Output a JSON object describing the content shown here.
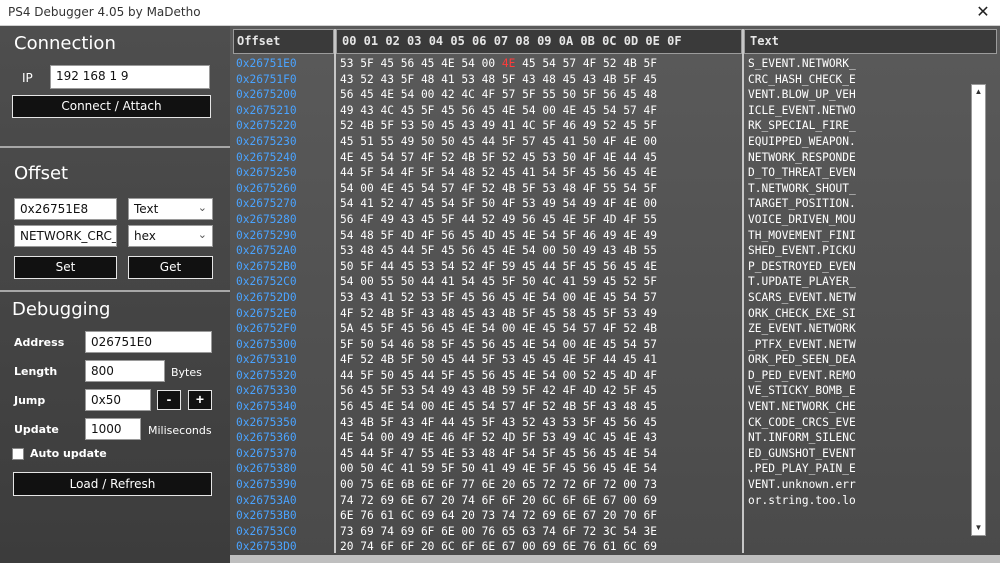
{
  "window": {
    "title": "PS4 Debugger 4.05 by MaDetho",
    "close_glyph": "✕"
  },
  "connection": {
    "title": "Connection",
    "ip_label": "IP",
    "ip_value": "192 168 1 9",
    "connect_label": "Connect / Attach"
  },
  "offset_section": {
    "title": "Offset",
    "offset_value": "0x26751E8",
    "type_value": "Text",
    "search_value": "NETWORK_CRC_",
    "format_value": "hex",
    "set_label": "Set",
    "get_label": "Get"
  },
  "debugging": {
    "title": "Debugging",
    "address_label": "Address",
    "address_value": "026751E0",
    "length_label": "Length",
    "length_value": "800",
    "length_unit": "Bytes",
    "jump_label": "Jump",
    "jump_value": "0x50",
    "minus_label": "-",
    "plus_label": "+",
    "update_label": "Update",
    "update_value": "1000",
    "update_unit": "Miliseconds",
    "auto_update_label": "Auto update",
    "load_label": "Load / Refresh"
  },
  "viewer": {
    "offset_header": "Offset",
    "hex_header": "00 01 02 03 04 05 06 07 08 09 0A 0B 0C 0D 0E 0F",
    "text_header": "Text",
    "highlight_color": "#ff3b3b",
    "offset_color": "#4aa3ff",
    "offsets": [
      "0x26751E0",
      "0x26751F0",
      "0x2675200",
      "0x2675210",
      "0x2675220",
      "0x2675230",
      "0x2675240",
      "0x2675250",
      "0x2675260",
      "0x2675270",
      "0x2675280",
      "0x2675290",
      "0x26752A0",
      "0x26752B0",
      "0x26752C0",
      "0x26752D0",
      "0x26752E0",
      "0x26752F0",
      "0x2675300",
      "0x2675310",
      "0x2675320",
      "0x2675330",
      "0x2675340",
      "0x2675350",
      "0x2675360",
      "0x2675370",
      "0x2675380",
      "0x2675390",
      "0x26753A0",
      "0x26753B0",
      "0x26753C0",
      "0x26753D0"
    ],
    "hex_rows": [
      "53 5F 45 56 45 4E 54 00 4E 45 54 57 4F 52 4B 5F",
      "43 52 43 5F 48 41 53 48 5F 43 48 45 43 4B 5F 45",
      "56 45 4E 54 00 42 4C 4F 57 5F 55 50 5F 56 45 48",
      "49 43 4C 45 5F 45 56 45 4E 54 00 4E 45 54 57 4F",
      "52 4B 5F 53 50 45 43 49 41 4C 5F 46 49 52 45 5F",
      "45 51 55 49 50 50 45 44 5F 57 45 41 50 4F 4E 00",
      "4E 45 54 57 4F 52 4B 5F 52 45 53 50 4F 4E 44 45",
      "44 5F 54 4F 5F 54 48 52 45 41 54 5F 45 56 45 4E",
      "54 00 4E 45 54 57 4F 52 4B 5F 53 48 4F 55 54 5F",
      "54 41 52 47 45 54 5F 50 4F 53 49 54 49 4F 4E 00",
      "56 4F 49 43 45 5F 44 52 49 56 45 4E 5F 4D 4F 55",
      "54 48 5F 4D 4F 56 45 4D 45 4E 54 5F 46 49 4E 49",
      "53 48 45 44 5F 45 56 45 4E 54 00 50 49 43 4B 55",
      "50 5F 44 45 53 54 52 4F 59 45 44 5F 45 56 45 4E",
      "54 00 55 50 44 41 54 45 5F 50 4C 41 59 45 52 5F",
      "53 43 41 52 53 5F 45 56 45 4E 54 00 4E 45 54 57",
      "4F 52 4B 5F 43 48 45 43 4B 5F 45 58 45 5F 53 49",
      "5A 45 5F 45 56 45 4E 54 00 4E 45 54 57 4F 52 4B",
      "5F 50 54 46 58 5F 45 56 45 4E 54 00 4E 45 54 57",
      "4F 52 4B 5F 50 45 44 5F 53 45 45 4E 5F 44 45 41",
      "44 5F 50 45 44 5F 45 56 45 4E 54 00 52 45 4D 4F",
      "56 45 5F 53 54 49 43 4B 59 5F 42 4F 4D 42 5F 45",
      "56 45 4E 54 00 4E 45 54 57 4F 52 4B 5F 43 48 45",
      "43 4B 5F 43 4F 44 45 5F 43 52 43 53 5F 45 56 45",
      "4E 54 00 49 4E 46 4F 52 4D 5F 53 49 4C 45 4E 43",
      "45 44 5F 47 55 4E 53 48 4F 54 5F 45 56 45 4E 54",
      "00 50 4C 41 59 5F 50 41 49 4E 5F 45 56 45 4E 54",
      "00 75 6E 6B 6E 6F 77 6E 20 65 72 72 6F 72 00 73",
      "74 72 69 6E 67 20 74 6F 6F 20 6C 6F 6E 67 00 69",
      "6E 76 61 6C 69 64 20 73 74 72 69 6E 67 20 70 6F",
      "73 69 74 69 6F 6E 00 76 65 63 74 6F 72 3C 54 3E",
      "20 74 6F 6F 20 6C 6F 6E 67 00 69 6E 76 61 6C 69"
    ],
    "highlight": {
      "row": 0,
      "byte": 8
    },
    "text_rows": [
      "S_EVENT.NETWORK_",
      "CRC_HASH_CHECK_E",
      "VENT.BLOW_UP_VEH",
      "ICLE_EVENT.NETWO",
      "RK_SPECIAL_FIRE_",
      "EQUIPPED_WEAPON.",
      "NETWORK_RESPONDE",
      "D_TO_THREAT_EVEN",
      "T.NETWORK_SHOUT_",
      "TARGET_POSITION.",
      "VOICE_DRIVEN_MOU",
      "TH_MOVEMENT_FINI",
      "SHED_EVENT.PICKU",
      "P_DESTROYED_EVEN",
      "T.UPDATE_PLAYER_",
      "SCARS_EVENT.NETW",
      "ORK_CHECK_EXE_SI",
      "ZE_EVENT.NETWORK",
      "_PTFX_EVENT.NETW",
      "ORK_PED_SEEN_DEA",
      "D_PED_EVENT.REMO",
      "VE_STICKY_BOMB_E",
      "VENT.NETWORK_CHE",
      "CK_CODE_CRCS_EVE",
      "NT.INFORM_SILENC",
      "ED_GUNSHOT_EVENT",
      ".PED_PLAY_PAIN_E",
      "VENT.unknown.err",
      "or.string.too.lo"
    ],
    "scroll_up": "▲",
    "scroll_down": "▼"
  }
}
